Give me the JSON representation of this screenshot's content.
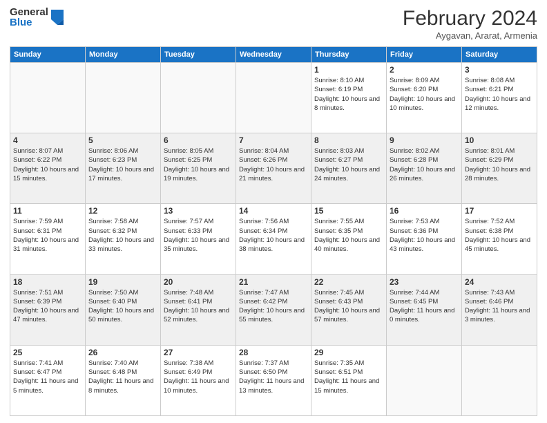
{
  "logo": {
    "general": "General",
    "blue": "Blue"
  },
  "title": {
    "month_year": "February 2024",
    "location": "Aygavan, Ararat, Armenia"
  },
  "headers": [
    "Sunday",
    "Monday",
    "Tuesday",
    "Wednesday",
    "Thursday",
    "Friday",
    "Saturday"
  ],
  "weeks": [
    [
      {
        "day": "",
        "info": ""
      },
      {
        "day": "",
        "info": ""
      },
      {
        "day": "",
        "info": ""
      },
      {
        "day": "",
        "info": ""
      },
      {
        "day": "1",
        "info": "Sunrise: 8:10 AM\nSunset: 6:19 PM\nDaylight: 10 hours and 8 minutes."
      },
      {
        "day": "2",
        "info": "Sunrise: 8:09 AM\nSunset: 6:20 PM\nDaylight: 10 hours and 10 minutes."
      },
      {
        "day": "3",
        "info": "Sunrise: 8:08 AM\nSunset: 6:21 PM\nDaylight: 10 hours and 12 minutes."
      }
    ],
    [
      {
        "day": "4",
        "info": "Sunrise: 8:07 AM\nSunset: 6:22 PM\nDaylight: 10 hours and 15 minutes."
      },
      {
        "day": "5",
        "info": "Sunrise: 8:06 AM\nSunset: 6:23 PM\nDaylight: 10 hours and 17 minutes."
      },
      {
        "day": "6",
        "info": "Sunrise: 8:05 AM\nSunset: 6:25 PM\nDaylight: 10 hours and 19 minutes."
      },
      {
        "day": "7",
        "info": "Sunrise: 8:04 AM\nSunset: 6:26 PM\nDaylight: 10 hours and 21 minutes."
      },
      {
        "day": "8",
        "info": "Sunrise: 8:03 AM\nSunset: 6:27 PM\nDaylight: 10 hours and 24 minutes."
      },
      {
        "day": "9",
        "info": "Sunrise: 8:02 AM\nSunset: 6:28 PM\nDaylight: 10 hours and 26 minutes."
      },
      {
        "day": "10",
        "info": "Sunrise: 8:01 AM\nSunset: 6:29 PM\nDaylight: 10 hours and 28 minutes."
      }
    ],
    [
      {
        "day": "11",
        "info": "Sunrise: 7:59 AM\nSunset: 6:31 PM\nDaylight: 10 hours and 31 minutes."
      },
      {
        "day": "12",
        "info": "Sunrise: 7:58 AM\nSunset: 6:32 PM\nDaylight: 10 hours and 33 minutes."
      },
      {
        "day": "13",
        "info": "Sunrise: 7:57 AM\nSunset: 6:33 PM\nDaylight: 10 hours and 35 minutes."
      },
      {
        "day": "14",
        "info": "Sunrise: 7:56 AM\nSunset: 6:34 PM\nDaylight: 10 hours and 38 minutes."
      },
      {
        "day": "15",
        "info": "Sunrise: 7:55 AM\nSunset: 6:35 PM\nDaylight: 10 hours and 40 minutes."
      },
      {
        "day": "16",
        "info": "Sunrise: 7:53 AM\nSunset: 6:36 PM\nDaylight: 10 hours and 43 minutes."
      },
      {
        "day": "17",
        "info": "Sunrise: 7:52 AM\nSunset: 6:38 PM\nDaylight: 10 hours and 45 minutes."
      }
    ],
    [
      {
        "day": "18",
        "info": "Sunrise: 7:51 AM\nSunset: 6:39 PM\nDaylight: 10 hours and 47 minutes."
      },
      {
        "day": "19",
        "info": "Sunrise: 7:50 AM\nSunset: 6:40 PM\nDaylight: 10 hours and 50 minutes."
      },
      {
        "day": "20",
        "info": "Sunrise: 7:48 AM\nSunset: 6:41 PM\nDaylight: 10 hours and 52 minutes."
      },
      {
        "day": "21",
        "info": "Sunrise: 7:47 AM\nSunset: 6:42 PM\nDaylight: 10 hours and 55 minutes."
      },
      {
        "day": "22",
        "info": "Sunrise: 7:45 AM\nSunset: 6:43 PM\nDaylight: 10 hours and 57 minutes."
      },
      {
        "day": "23",
        "info": "Sunrise: 7:44 AM\nSunset: 6:45 PM\nDaylight: 11 hours and 0 minutes."
      },
      {
        "day": "24",
        "info": "Sunrise: 7:43 AM\nSunset: 6:46 PM\nDaylight: 11 hours and 3 minutes."
      }
    ],
    [
      {
        "day": "25",
        "info": "Sunrise: 7:41 AM\nSunset: 6:47 PM\nDaylight: 11 hours and 5 minutes."
      },
      {
        "day": "26",
        "info": "Sunrise: 7:40 AM\nSunset: 6:48 PM\nDaylight: 11 hours and 8 minutes."
      },
      {
        "day": "27",
        "info": "Sunrise: 7:38 AM\nSunset: 6:49 PM\nDaylight: 11 hours and 10 minutes."
      },
      {
        "day": "28",
        "info": "Sunrise: 7:37 AM\nSunset: 6:50 PM\nDaylight: 11 hours and 13 minutes."
      },
      {
        "day": "29",
        "info": "Sunrise: 7:35 AM\nSunset: 6:51 PM\nDaylight: 11 hours and 15 minutes."
      },
      {
        "day": "",
        "info": ""
      },
      {
        "day": "",
        "info": ""
      }
    ]
  ]
}
